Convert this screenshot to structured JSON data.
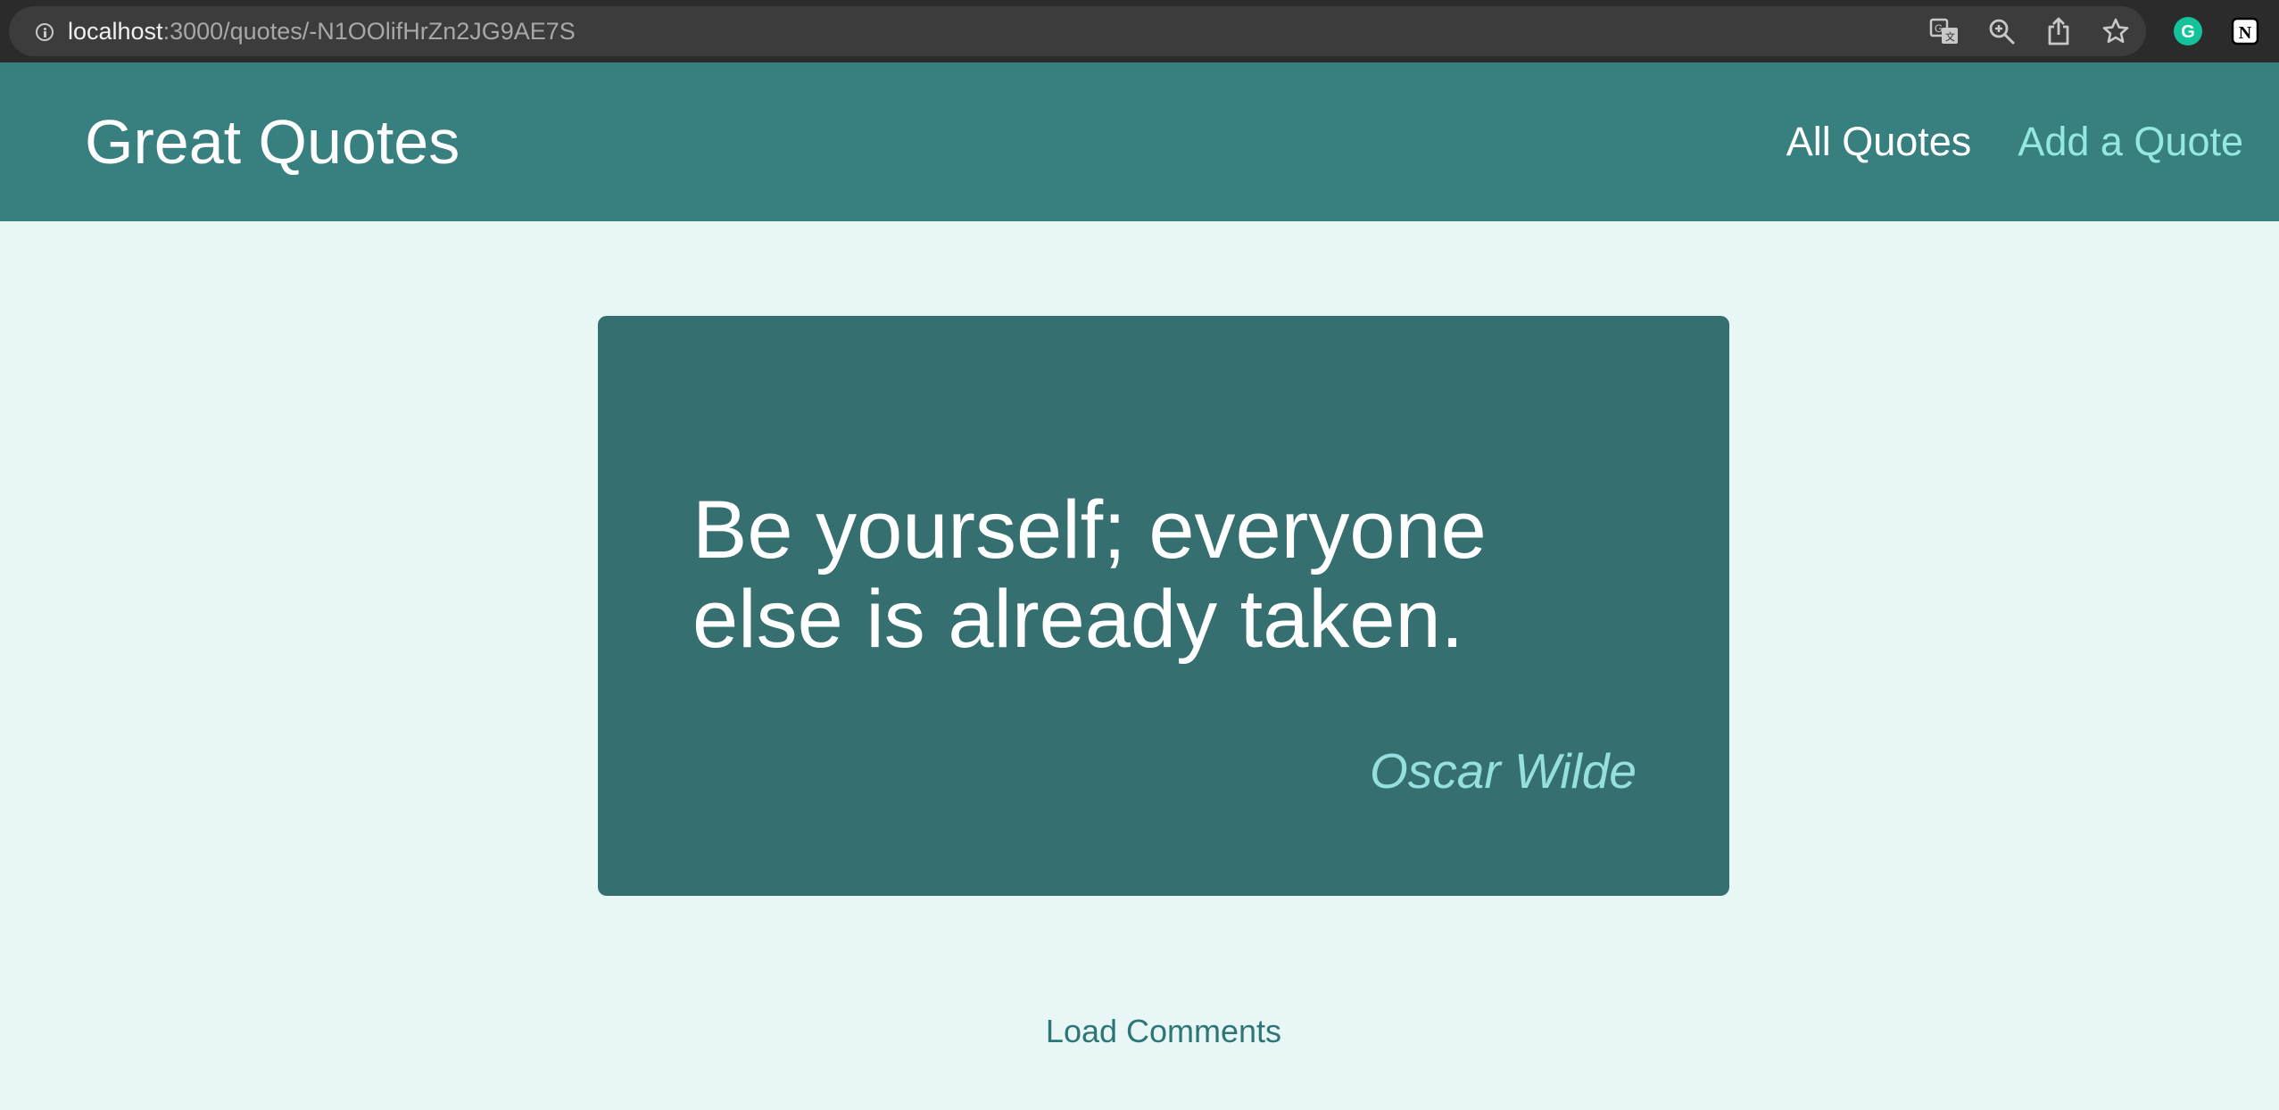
{
  "browser": {
    "url_host": "localhost",
    "url_path": ":3000/quotes/-N1OOlifHrZn2JG9AE7S",
    "extension_g_letter": "G",
    "extension_n_letter": "N"
  },
  "header": {
    "logo": "Great Quotes",
    "nav": [
      {
        "label": "All Quotes"
      },
      {
        "label": "Add a Quote"
      }
    ]
  },
  "quote": {
    "text": "Be yourself; everyone else is already taken.",
    "author": "Oscar Wilde"
  },
  "comments": {
    "load_label": "Load Comments"
  },
  "colors": {
    "header_bg": "#388080",
    "page_bg": "#e8f6f6",
    "card_bg": "#366f6f",
    "accent": "#95e8df"
  }
}
